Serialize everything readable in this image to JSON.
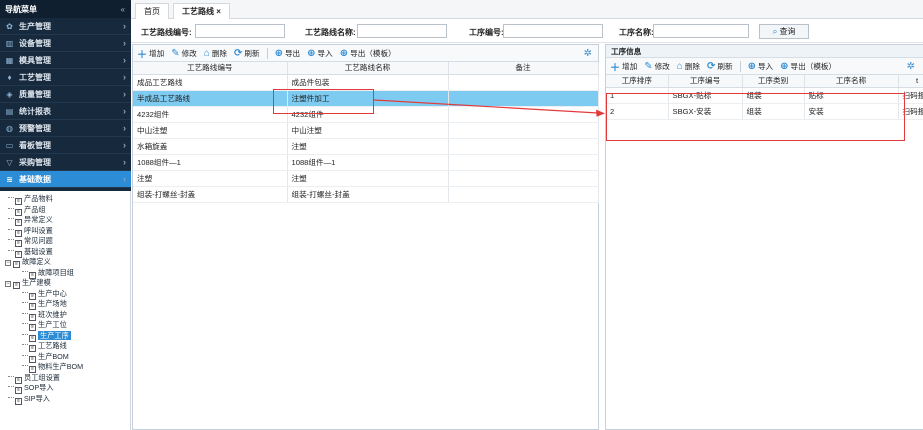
{
  "sidebar": {
    "title": "导航菜单",
    "collapse_icon": "«",
    "menus": [
      {
        "label": "生产管理",
        "icon": "gear-icon",
        "glyph": "✿"
      },
      {
        "label": "设备管理",
        "icon": "bars-icon",
        "glyph": "▥"
      },
      {
        "label": "模具管理",
        "icon": "grid-icon",
        "glyph": "▦"
      },
      {
        "label": "工艺管理",
        "icon": "shield-icon",
        "glyph": "♦"
      },
      {
        "label": "质量管理",
        "icon": "shield-check-icon",
        "glyph": "◈"
      },
      {
        "label": "统计报表",
        "icon": "chart-icon",
        "glyph": "▤"
      },
      {
        "label": "预警管理",
        "icon": "alert-icon",
        "glyph": "◍"
      },
      {
        "label": "看板管理",
        "icon": "monitor-icon",
        "glyph": "▭"
      },
      {
        "label": "采购管理",
        "icon": "cart-icon",
        "glyph": "▽"
      },
      {
        "label": "基础数据",
        "icon": "layers-icon",
        "glyph": "≋"
      }
    ],
    "tree": [
      {
        "label": "产品物料",
        "level": 1
      },
      {
        "label": "产品组",
        "level": 1
      },
      {
        "label": "异常定义",
        "level": 1
      },
      {
        "label": "呼叫设置",
        "level": 1
      },
      {
        "label": "常见问题",
        "level": 1
      },
      {
        "label": "基础设置",
        "level": 1
      },
      {
        "label": "故障定义",
        "level": 0,
        "expand": "⊟"
      },
      {
        "label": "故障项目组",
        "level": 2
      },
      {
        "label": "生产建模",
        "level": 0,
        "expand": "⊟"
      },
      {
        "label": "生产中心",
        "level": 2
      },
      {
        "label": "生产场地",
        "level": 2
      },
      {
        "label": "班次维护",
        "level": 2
      },
      {
        "label": "生产工位",
        "level": 2
      },
      {
        "label": "生产工序",
        "level": 2,
        "selected": true
      },
      {
        "label": "工艺路线",
        "level": 2
      },
      {
        "label": "生产BOM",
        "level": 2
      },
      {
        "label": "物料生产BOM",
        "level": 2
      },
      {
        "label": "员工组设置",
        "level": 1
      },
      {
        "label": "SOP导入",
        "level": 1
      },
      {
        "label": "SIP导入",
        "level": 1
      }
    ]
  },
  "tabs": [
    {
      "label": "首页"
    },
    {
      "label": "工艺路线 ×",
      "active": true
    }
  ],
  "search": {
    "route_code_label": "工艺路线编号:",
    "route_name_label": "工艺路线名称:",
    "proc_code_label": "工序编号:",
    "proc_name_label": "工序名称:",
    "query_label": "查询"
  },
  "left_toolbar": {
    "add": "增加",
    "edit": "修改",
    "delete": "删除",
    "refresh": "刷新",
    "export": "导出",
    "import": "导入",
    "export_tpl": "导出（模板）"
  },
  "left_table": {
    "headers": [
      "工艺路线编号",
      "工艺路线名称",
      "备注"
    ],
    "rows": [
      [
        "成品工艺路线",
        "成品件包装",
        ""
      ],
      [
        "半成品工艺路线",
        "注塑件加工",
        ""
      ],
      [
        "4232组件",
        "4232组件",
        ""
      ],
      [
        "中山注塑",
        "中山注塑",
        ""
      ],
      [
        "水箱旋盖",
        "注塑",
        ""
      ],
      [
        "1088组件—1",
        "1088组件—1",
        ""
      ],
      [
        "注塑",
        "注塑",
        ""
      ],
      [
        "组装-打螺丝-封盖",
        "组装-打螺丝-封盖",
        ""
      ]
    ],
    "selected_index": 1
  },
  "right_panel": {
    "title": "工序信息",
    "toolbar": {
      "add": "增加",
      "edit": "修改",
      "delete": "删除",
      "refresh": "刷新",
      "import": "导入",
      "export_tpl": "导出（模板）"
    },
    "headers": [
      "工序排序",
      "工序编号",
      "工序类别",
      "工序名称",
      "t"
    ],
    "rows": [
      [
        "1",
        "SBGX-贴标",
        "组装",
        "贴标",
        "扫码报"
      ],
      [
        "2",
        "SBGX-安装",
        "组装",
        "安装",
        "扫码报"
      ]
    ]
  },
  "colors": {
    "sidebar_bg": "#172a3d",
    "accent": "#2d8cd6",
    "selected_row": "#7ecbf1",
    "annotation_red": "#e23a3a"
  }
}
